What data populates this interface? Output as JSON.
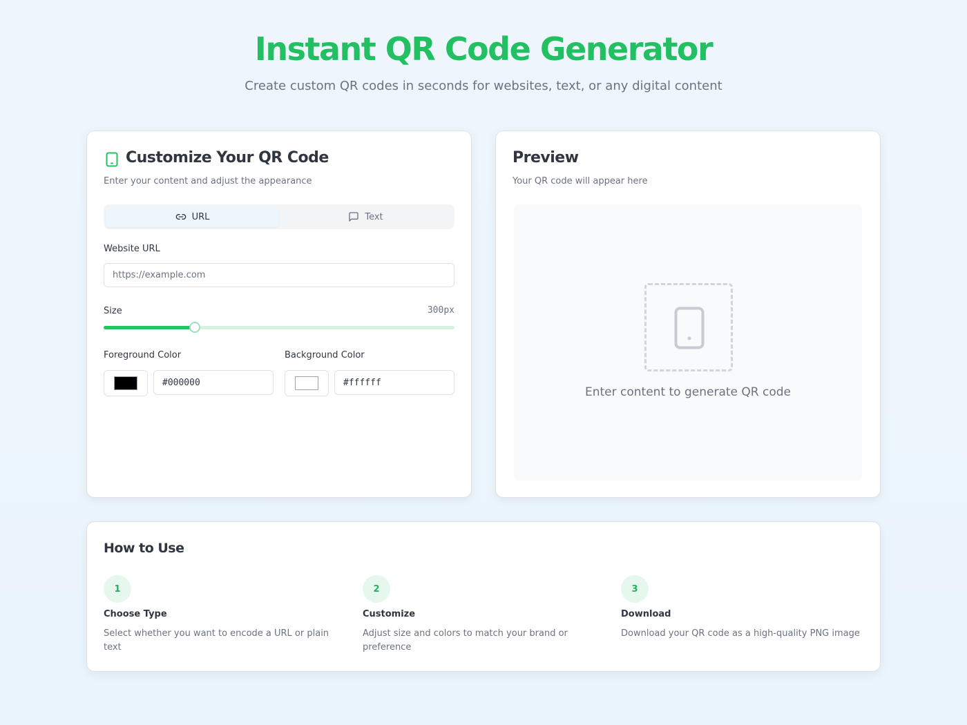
{
  "header": {
    "title": "Instant QR Code Generator",
    "subtitle": "Create custom QR codes in seconds for websites, text, or any digital content"
  },
  "customize": {
    "title": "Customize Your QR Code",
    "description": "Enter your content and adjust the appearance",
    "icon": "smartphone-icon",
    "tabs": [
      {
        "label": "URL",
        "icon": "link-icon",
        "active": true
      },
      {
        "label": "Text",
        "icon": "message-square-icon",
        "active": false
      }
    ],
    "url_label": "Website URL",
    "url_value": "",
    "url_placeholder": "https://example.com",
    "size_label": "Size",
    "size_value": "300px",
    "size_fraction": 0.26,
    "fg_label": "Foreground Color",
    "fg_value": "#000000",
    "bg_label": "Background Color",
    "bg_value": "#ffffff"
  },
  "preview": {
    "title": "Preview",
    "description": "Your QR code will appear here",
    "placeholder_text": "Enter content to generate QR code",
    "placeholder_icon": "smartphone-icon"
  },
  "howto": {
    "title": "How to Use",
    "steps": [
      {
        "number": "1",
        "title": "Choose Type",
        "description": "Select whether you want to encode a URL or plain text"
      },
      {
        "number": "2",
        "title": "Customize",
        "description": "Adjust size and colors to match your brand or preference"
      },
      {
        "number": "3",
        "title": "Download",
        "description": "Download your QR code as a high-quality PNG image"
      }
    ]
  },
  "colors": {
    "accent": "#22c063",
    "slider_fill": "#22c55e",
    "slider_track": "#d4f3e0"
  }
}
